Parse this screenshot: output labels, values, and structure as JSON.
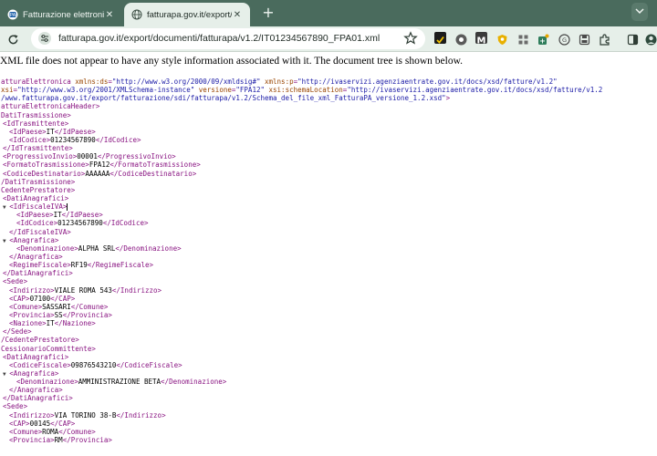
{
  "tabs": [
    {
      "title": "Fatturazione elettronica PA - Fo",
      "close": "✕",
      "favicon": "pa-icon"
    },
    {
      "title": "fatturapa.gov.it/export/docume",
      "close": "✕",
      "favicon": "globe-icon"
    }
  ],
  "new_tab_label": "+",
  "toolbar": {
    "url": "fatturapa.gov.it/export/documenti/fatturapa/v1.2/IT01234567890_FPA01.xml",
    "extensions": [
      "extension-icon",
      "chrome-icon",
      "gmail-icon",
      "shield-extension-icon",
      "grid-extension-icon",
      "plus-extension-icon",
      "translate-extension-icon",
      "save-extension-icon",
      "puzzle-icon",
      "sidebar-icon",
      "account-icon"
    ]
  },
  "banner": "XML file does not appear to have any style information associated with it. The document tree is shown below.",
  "xml_lines": [
    {
      "ind": 0,
      "tri": "",
      "segs": [
        {
          "c": "tag",
          "t": "atturaElettronica "
        },
        {
          "c": "an",
          "t": "xmlns:ds"
        },
        {
          "c": "tag",
          "t": "="
        },
        {
          "c": "av",
          "t": "\"http://www.w3.org/2000/09/xmldsig#\""
        },
        {
          "c": "tag",
          "t": " "
        },
        {
          "c": "an",
          "t": "xmlns:p"
        },
        {
          "c": "tag",
          "t": "="
        },
        {
          "c": "av",
          "t": "\"http://ivaservizi.agenziaentrate.gov.it/docs/xsd/fatture/v1.2\""
        }
      ]
    },
    {
      "ind": 0,
      "tri": "",
      "segs": [
        {
          "c": "an",
          "t": "xsi"
        },
        {
          "c": "tag",
          "t": "="
        },
        {
          "c": "av",
          "t": "\"http://www.w3.org/2001/XMLSchema-instance\""
        },
        {
          "c": "tag",
          "t": " "
        },
        {
          "c": "an",
          "t": "versione"
        },
        {
          "c": "tag",
          "t": "="
        },
        {
          "c": "av",
          "t": "\"FPA12\""
        },
        {
          "c": "tag",
          "t": " "
        },
        {
          "c": "an",
          "t": "xsi:schemaLocation"
        },
        {
          "c": "tag",
          "t": "="
        },
        {
          "c": "av",
          "t": "\"http://ivaservizi.agenziaentrate.gov.it/docs/xsd/fatture/v1.2"
        }
      ]
    },
    {
      "ind": 0,
      "tri": "",
      "segs": [
        {
          "c": "av",
          "t": "/www.fatturapa.gov.it/export/fatturazione/sdi/fatturapa/v1.2/Schema_del_file_xml_FatturaPA_versione_1.2.xsd\""
        },
        {
          "c": "tag",
          "t": ">"
        }
      ]
    },
    {
      "ind": 0,
      "tri": "",
      "segs": [
        {
          "c": "tag",
          "t": "atturaElettronicaHeader>"
        }
      ]
    },
    {
      "ind": 0,
      "tri": "",
      "segs": [
        {
          "c": "tag",
          "t": "DatiTrasmissione>"
        }
      ]
    },
    {
      "ind": 1,
      "tri": "",
      "segs": [
        {
          "c": "tag",
          "t": "<IdTrasmittente>"
        }
      ]
    },
    {
      "ind": 2,
      "tri": "",
      "segs": [
        {
          "c": "tag",
          "t": "<IdPaese>"
        },
        {
          "c": "tx",
          "t": "IT"
        },
        {
          "c": "tag",
          "t": "</IdPaese>"
        }
      ]
    },
    {
      "ind": 2,
      "tri": "",
      "segs": [
        {
          "c": "tag",
          "t": "<IdCodice>"
        },
        {
          "c": "tx",
          "t": "01234567890"
        },
        {
          "c": "tag",
          "t": "</IdCodice>"
        }
      ]
    },
    {
      "ind": 1,
      "tri": "",
      "segs": [
        {
          "c": "tag",
          "t": "</IdTrasmittente>"
        }
      ]
    },
    {
      "ind": 1,
      "tri": "",
      "segs": [
        {
          "c": "tag",
          "t": "<ProgressivoInvio>"
        },
        {
          "c": "tx",
          "t": "00001"
        },
        {
          "c": "tag",
          "t": "</ProgressivoInvio>"
        }
      ]
    },
    {
      "ind": 1,
      "tri": "",
      "segs": [
        {
          "c": "tag",
          "t": "<FormatoTrasmissione>"
        },
        {
          "c": "tx",
          "t": "FPA12"
        },
        {
          "c": "tag",
          "t": "</FormatoTrasmissione>"
        }
      ]
    },
    {
      "ind": 1,
      "tri": "",
      "segs": [
        {
          "c": "tag",
          "t": "<CodiceDestinatario>"
        },
        {
          "c": "tx",
          "t": "AAAAAA"
        },
        {
          "c": "tag",
          "t": "</CodiceDestinatario>"
        }
      ]
    },
    {
      "ind": 0,
      "tri": "",
      "segs": [
        {
          "c": "tag",
          "t": "/DatiTrasmissione>"
        }
      ]
    },
    {
      "ind": 0,
      "tri": "",
      "segs": [
        {
          "c": "tag",
          "t": "CedentePrestatore>"
        }
      ]
    },
    {
      "ind": 1,
      "tri": "",
      "segs": [
        {
          "c": "tag",
          "t": "<DatiAnagrafici>"
        }
      ]
    },
    {
      "ind": 1,
      "tri": "▼",
      "caret": true,
      "segs": [
        {
          "c": "tag",
          "t": "<IdFiscaleIVA>"
        }
      ]
    },
    {
      "ind": 3,
      "tri": "",
      "segs": [
        {
          "c": "tag",
          "t": "<IdPaese>"
        },
        {
          "c": "tx",
          "t": "IT"
        },
        {
          "c": "tag",
          "t": "</IdPaese>"
        }
      ]
    },
    {
      "ind": 3,
      "tri": "",
      "segs": [
        {
          "c": "tag",
          "t": "<IdCodice>"
        },
        {
          "c": "tx",
          "t": "01234567890"
        },
        {
          "c": "tag",
          "t": "</IdCodice>"
        }
      ]
    },
    {
      "ind": 2,
      "tri": "",
      "segs": [
        {
          "c": "tag",
          "t": "</IdFiscaleIVA>"
        }
      ]
    },
    {
      "ind": 1,
      "tri": "▼",
      "segs": [
        {
          "c": "tag",
          "t": "<Anagrafica>"
        }
      ]
    },
    {
      "ind": 3,
      "tri": "",
      "segs": [
        {
          "c": "tag",
          "t": "<Denominazione>"
        },
        {
          "c": "tx",
          "t": "ALPHA SRL"
        },
        {
          "c": "tag",
          "t": "</Denominazione>"
        }
      ]
    },
    {
      "ind": 2,
      "tri": "",
      "segs": [
        {
          "c": "tag",
          "t": "</Anagrafica>"
        }
      ]
    },
    {
      "ind": 2,
      "tri": "",
      "segs": [
        {
          "c": "tag",
          "t": "<RegimeFiscale>"
        },
        {
          "c": "tx",
          "t": "RF19"
        },
        {
          "c": "tag",
          "t": "</RegimeFiscale>"
        }
      ]
    },
    {
      "ind": 1,
      "tri": "",
      "segs": [
        {
          "c": "tag",
          "t": "</DatiAnagrafici>"
        }
      ]
    },
    {
      "ind": 1,
      "tri": "",
      "segs": [
        {
          "c": "tag",
          "t": "<Sede>"
        }
      ]
    },
    {
      "ind": 2,
      "tri": "",
      "segs": [
        {
          "c": "tag",
          "t": "<Indirizzo>"
        },
        {
          "c": "tx",
          "t": "VIALE ROMA 543"
        },
        {
          "c": "tag",
          "t": "</Indirizzo>"
        }
      ]
    },
    {
      "ind": 2,
      "tri": "",
      "segs": [
        {
          "c": "tag",
          "t": "<CAP>"
        },
        {
          "c": "tx",
          "t": "07100"
        },
        {
          "c": "tag",
          "t": "</CAP>"
        }
      ]
    },
    {
      "ind": 2,
      "tri": "",
      "segs": [
        {
          "c": "tag",
          "t": "<Comune>"
        },
        {
          "c": "tx",
          "t": "SASSARI"
        },
        {
          "c": "tag",
          "t": "</Comune>"
        }
      ]
    },
    {
      "ind": 2,
      "tri": "",
      "segs": [
        {
          "c": "tag",
          "t": "<Provincia>"
        },
        {
          "c": "tx",
          "t": "SS"
        },
        {
          "c": "tag",
          "t": "</Provincia>"
        }
      ]
    },
    {
      "ind": 2,
      "tri": "",
      "segs": [
        {
          "c": "tag",
          "t": "<Nazione>"
        },
        {
          "c": "tx",
          "t": "IT"
        },
        {
          "c": "tag",
          "t": "</Nazione>"
        }
      ]
    },
    {
      "ind": 1,
      "tri": "",
      "segs": [
        {
          "c": "tag",
          "t": "</Sede>"
        }
      ]
    },
    {
      "ind": 0,
      "tri": "",
      "segs": [
        {
          "c": "tag",
          "t": "/CedentePrestatore>"
        }
      ]
    },
    {
      "ind": 0,
      "tri": "",
      "segs": [
        {
          "c": "tag",
          "t": "CessionarioCommittente>"
        }
      ]
    },
    {
      "ind": 1,
      "tri": "",
      "segs": [
        {
          "c": "tag",
          "t": "<DatiAnagrafici>"
        }
      ]
    },
    {
      "ind": 2,
      "tri": "",
      "segs": [
        {
          "c": "tag",
          "t": "<CodiceFiscale>"
        },
        {
          "c": "tx",
          "t": "09876543210"
        },
        {
          "c": "tag",
          "t": "</CodiceFiscale>"
        }
      ]
    },
    {
      "ind": 1,
      "tri": "▼",
      "segs": [
        {
          "c": "tag",
          "t": "<Anagrafica>"
        }
      ]
    },
    {
      "ind": 3,
      "tri": "",
      "segs": [
        {
          "c": "tag",
          "t": "<Denominazione>"
        },
        {
          "c": "tx",
          "t": "AMMINISTRAZIONE BETA"
        },
        {
          "c": "tag",
          "t": "</Denominazione>"
        }
      ]
    },
    {
      "ind": 2,
      "tri": "",
      "segs": [
        {
          "c": "tag",
          "t": "</Anagrafica>"
        }
      ]
    },
    {
      "ind": 1,
      "tri": "",
      "segs": [
        {
          "c": "tag",
          "t": "</DatiAnagrafici>"
        }
      ]
    },
    {
      "ind": 1,
      "tri": "",
      "segs": [
        {
          "c": "tag",
          "t": "<Sede>"
        }
      ]
    },
    {
      "ind": 2,
      "tri": "",
      "segs": [
        {
          "c": "tag",
          "t": "<Indirizzo>"
        },
        {
          "c": "tx",
          "t": "VIA TORINO 38-B"
        },
        {
          "c": "tag",
          "t": "</Indirizzo>"
        }
      ]
    },
    {
      "ind": 2,
      "tri": "",
      "segs": [
        {
          "c": "tag",
          "t": "<CAP>"
        },
        {
          "c": "tx",
          "t": "00145"
        },
        {
          "c": "tag",
          "t": "</CAP>"
        }
      ]
    },
    {
      "ind": 2,
      "tri": "",
      "segs": [
        {
          "c": "tag",
          "t": "<Comune>"
        },
        {
          "c": "tx",
          "t": "ROMA"
        },
        {
          "c": "tag",
          "t": "</Comune>"
        }
      ]
    },
    {
      "ind": 2,
      "tri": "",
      "segs": [
        {
          "c": "tag",
          "t": "<Provincia>"
        },
        {
          "c": "tx",
          "t": "RM"
        },
        {
          "c": "tag",
          "t": "</Provincia>"
        }
      ]
    }
  ]
}
